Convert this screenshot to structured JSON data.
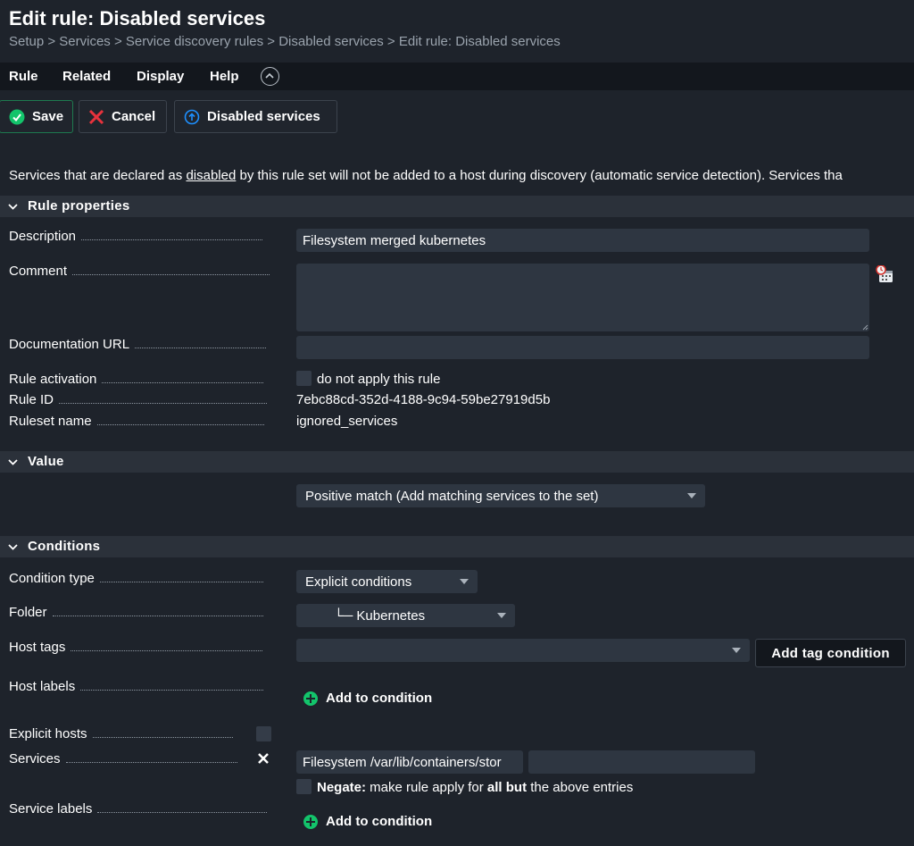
{
  "header": {
    "title": "Edit rule: Disabled services",
    "breadcrumb": "Setup > Services > Service discovery rules > Disabled services > Edit rule: Disabled services"
  },
  "menu": {
    "rule": "Rule",
    "related": "Related",
    "display": "Display",
    "help": "Help"
  },
  "toolbar": {
    "save": "Save",
    "cancel": "Cancel",
    "disabled_services": "Disabled services"
  },
  "intro": {
    "before": "Services that are declared as ",
    "link": "disabled",
    "after": " by this rule set will not be added to a host during discovery (automatic service detection). Services tha"
  },
  "rule_properties": {
    "title": "Rule properties",
    "description_label": "Description",
    "description_value": "Filesystem merged kubernetes",
    "comment_label": "Comment",
    "comment_value": "",
    "doc_url_label": "Documentation URL",
    "doc_url_value": "",
    "activation_label": "Rule activation",
    "activation_checkbox": "do not apply this rule",
    "rule_id_label": "Rule ID",
    "rule_id_value": "7ebc88cd-352d-4188-9c94-59be27919d5b",
    "ruleset_label": "Ruleset name",
    "ruleset_value": "ignored_services"
  },
  "value": {
    "title": "Value",
    "selected": "Positive match (Add matching services to the set)"
  },
  "conditions": {
    "title": "Conditions",
    "condition_type_label": "Condition type",
    "condition_type_value": "Explicit conditions",
    "folder_label": "Folder",
    "folder_value": "└─ Kubernetes",
    "host_tags_label": "Host tags",
    "host_tags_value": "",
    "add_tag_condition": "Add tag condition",
    "host_labels_label": "Host labels",
    "add_to_condition": "Add to condition",
    "explicit_hosts_label": "Explicit hosts",
    "services_label": "Services",
    "services_value": "Filesystem /var/lib/containers/stor",
    "services_value2": "",
    "negate_bold": "Negate:",
    "negate_mid": " make rule apply for ",
    "negate_allbut": "all but",
    "negate_end": " the above entries",
    "service_labels_label": "Service labels"
  },
  "colors": {
    "background": "#1e232b",
    "field": "#2e3641",
    "accent_green": "#13c46b",
    "cancel_red": "#e8323c",
    "info_blue": "#1e90ff"
  }
}
